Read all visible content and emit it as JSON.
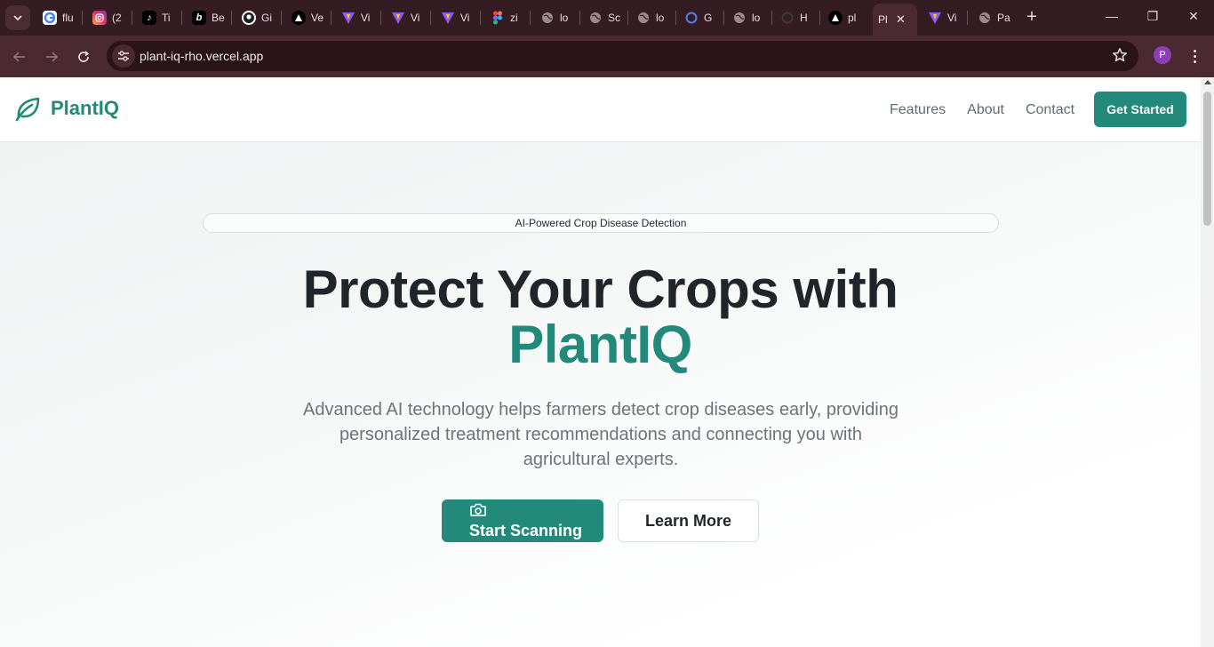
{
  "browser": {
    "tabs": [
      {
        "icon": "google-icon",
        "title": "flu"
      },
      {
        "icon": "instagram-icon",
        "title": "(2"
      },
      {
        "icon": "tiktok-icon",
        "title": "Ti"
      },
      {
        "icon": "behance-icon",
        "title": "Be"
      },
      {
        "icon": "github-icon",
        "title": "Gi"
      },
      {
        "icon": "vercel-icon",
        "title": "Ve"
      },
      {
        "icon": "vite-icon",
        "title": "Vi"
      },
      {
        "icon": "vite-icon",
        "title": "Vi"
      },
      {
        "icon": "vite-icon",
        "title": "Vi"
      },
      {
        "icon": "figma-icon",
        "title": "zi"
      },
      {
        "icon": "globe-icon",
        "title": "lo"
      },
      {
        "icon": "globe-icon",
        "title": "Sc"
      },
      {
        "icon": "globe-icon",
        "title": "lo"
      },
      {
        "icon": "g-ring-icon",
        "title": "G"
      },
      {
        "icon": "globe-icon",
        "title": "lo"
      },
      {
        "icon": "loading-icon",
        "title": "H"
      },
      {
        "icon": "vercel-icon",
        "title": "pl"
      },
      {
        "icon": "plantiq-icon",
        "title": "Pl",
        "active": true
      },
      {
        "icon": "vite-icon",
        "title": "Vi"
      },
      {
        "icon": "globe-icon",
        "title": "Pa"
      }
    ],
    "url": "plant-iq-rho.vercel.app",
    "profile_initial": "P"
  },
  "site": {
    "brand": "PlantIQ",
    "nav": [
      "Features",
      "About",
      "Contact"
    ],
    "nav_cta": "Get Started"
  },
  "hero": {
    "badge": "AI-Powered Crop Disease Detection",
    "title_line1": "Protect Your Crops with",
    "title_accent": "PlantIQ",
    "subtitle": "Advanced AI technology helps farmers detect crop diseases early, providing personalized treatment recommendations and connecting you with agricultural experts.",
    "primary_button": "Start Scanning",
    "secondary_button": "Learn More"
  },
  "colors": {
    "brand": "#23897a",
    "chrome_dark": "#351c22",
    "chrome_toolbar": "#4a2a30"
  }
}
